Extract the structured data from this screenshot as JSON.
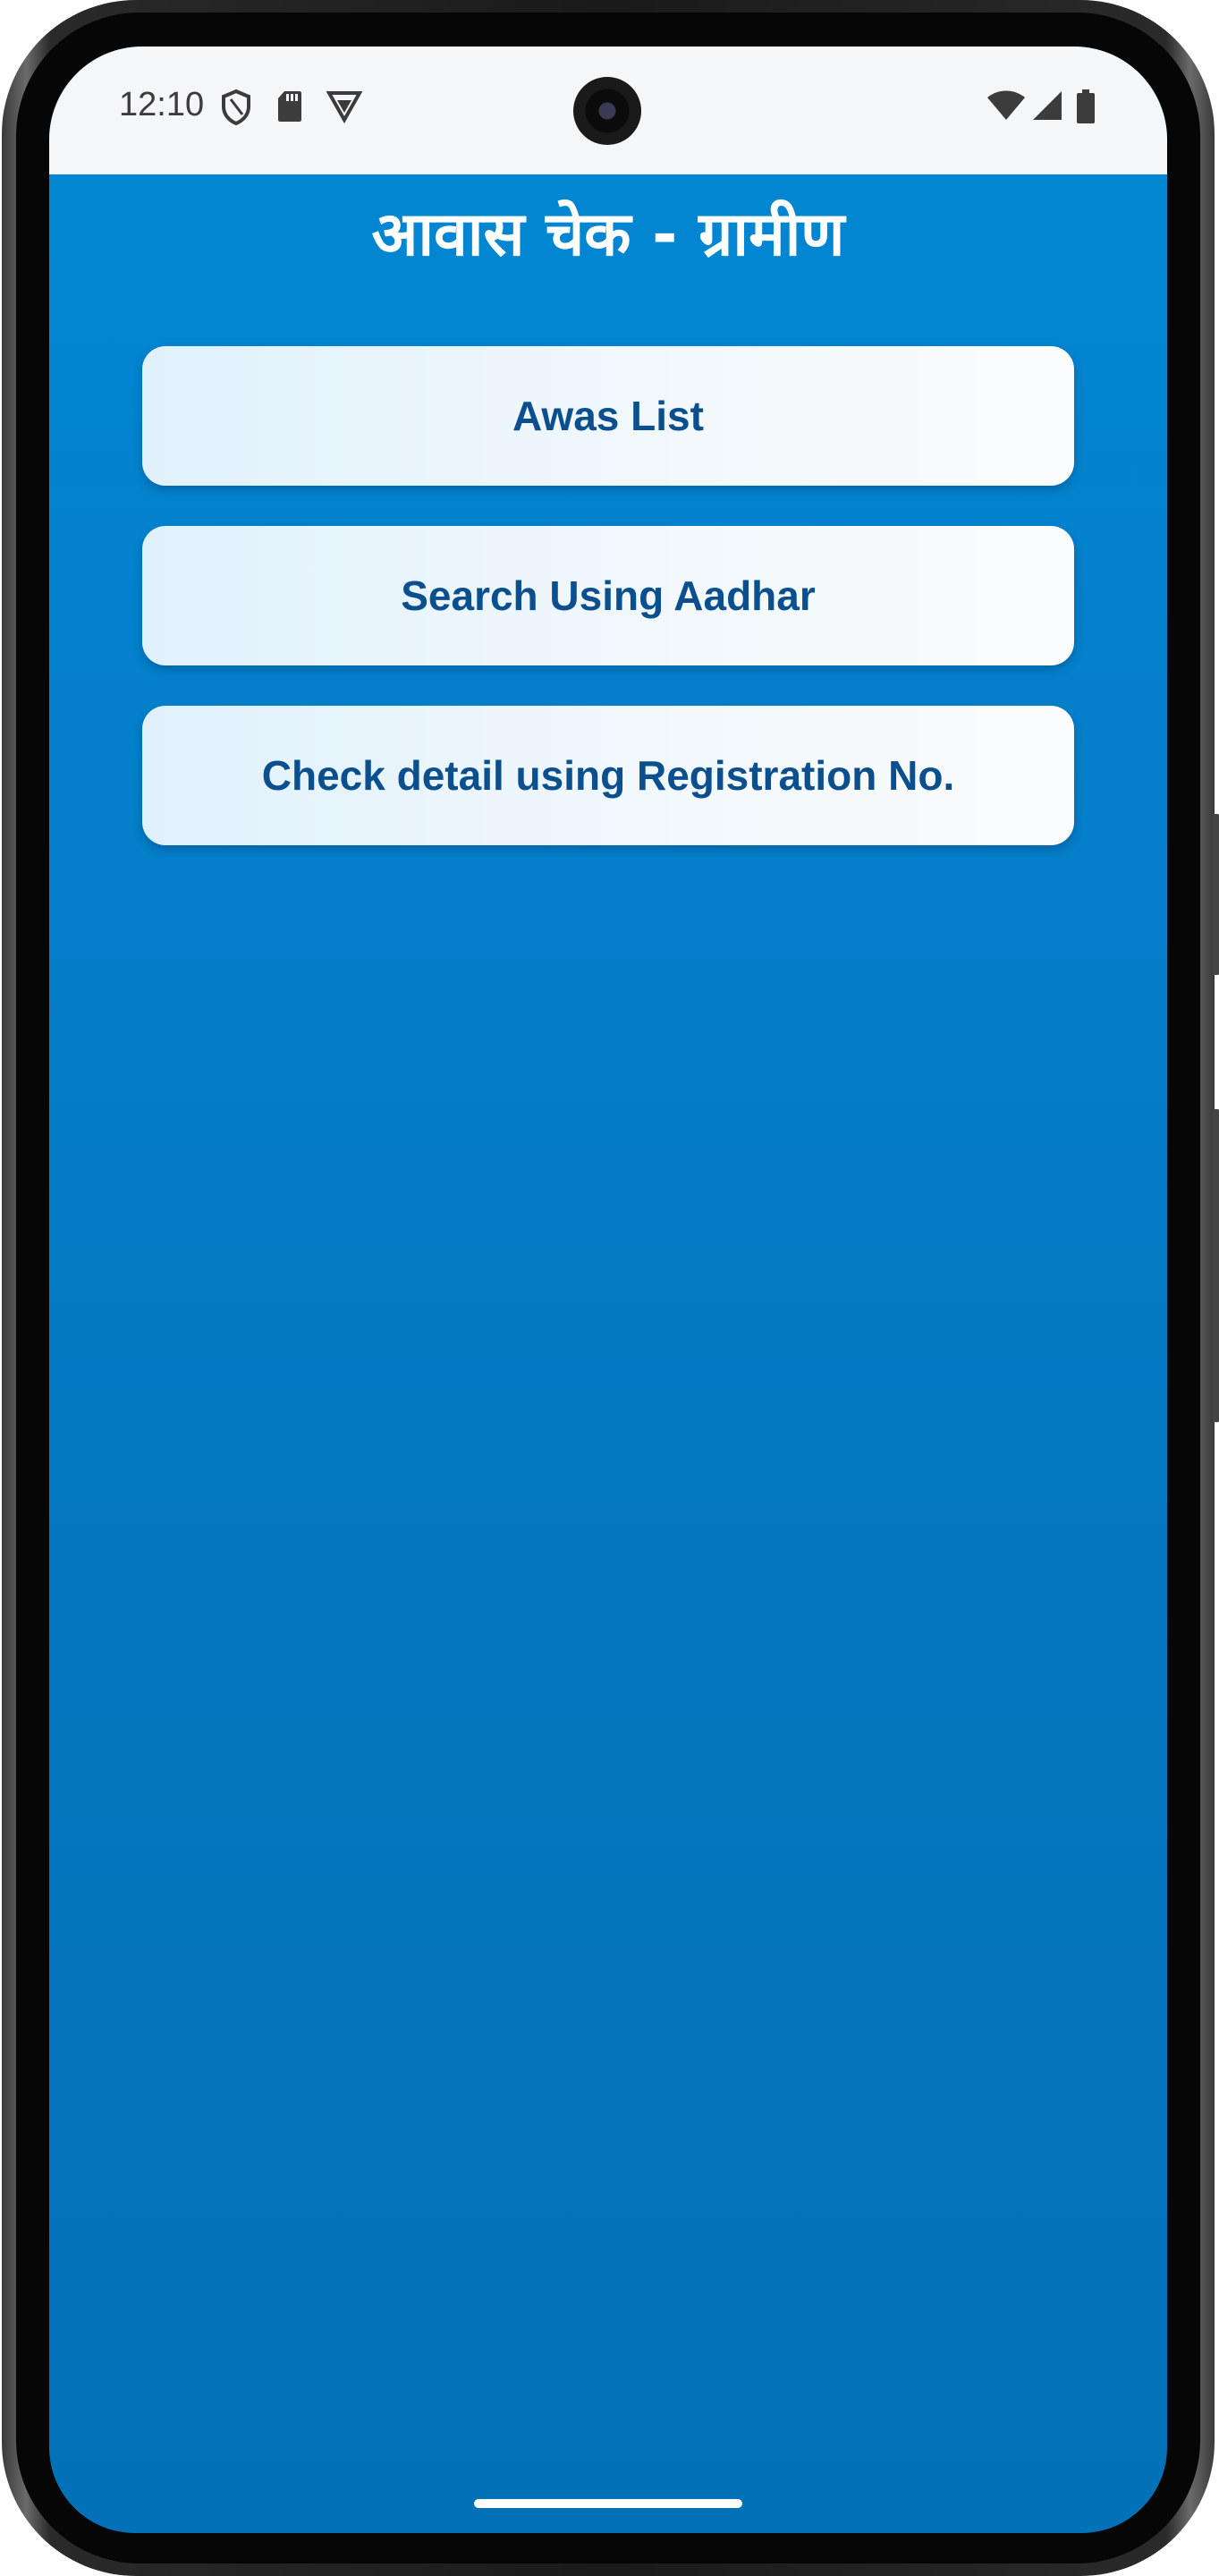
{
  "status_bar": {
    "time": "12:10",
    "left_icons": [
      "shield-icon",
      "sd-card-icon",
      "vpn-icon"
    ],
    "right_icons": [
      "wifi-icon",
      "signal-icon",
      "battery-icon"
    ]
  },
  "app": {
    "title": "आवास चेक - ग्रामीण"
  },
  "menu": {
    "items": [
      {
        "label": "Awas List"
      },
      {
        "label": "Search Using Aadhar"
      },
      {
        "label": "Check detail using Registration No."
      }
    ]
  },
  "colors": {
    "background": "#0388d4",
    "button_text": "#0b4f8e",
    "title_text": "#ffffff"
  }
}
